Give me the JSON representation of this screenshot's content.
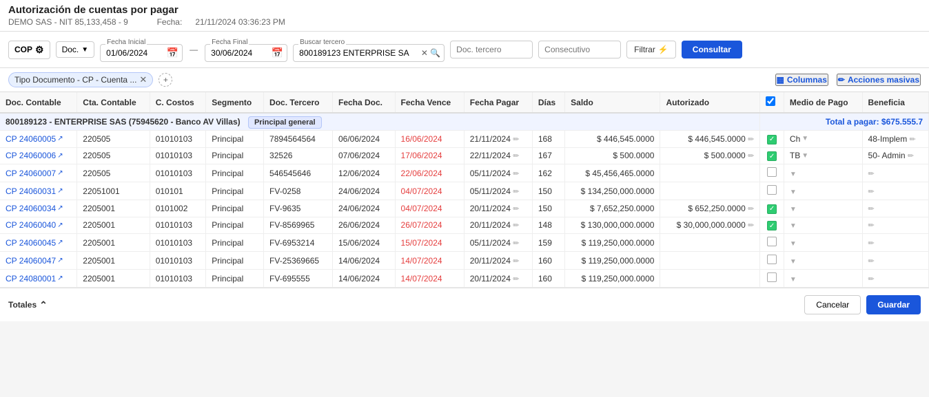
{
  "header": {
    "title": "Autorización de cuentas por pagar",
    "company": "DEMO SAS - NIT 85,133,458 - 9",
    "fecha_label": "Fecha:",
    "fecha_value": "21/11/2024 03:36:23 PM"
  },
  "toolbar": {
    "currency": "COP",
    "doc_label": "Doc.",
    "fecha_inicial_label": "Fecha Inicial",
    "fecha_inicial_value": "01/06/2024",
    "fecha_final_label": "Fecha Final",
    "fecha_final_value": "30/06/2024",
    "buscar_tercero_label": "Buscar tercero",
    "buscar_tercero_value": "800189123 ENTERPRISE SAS",
    "doc_tercero_placeholder": "Doc. tercero",
    "consecutivo_placeholder": "Consecutivo",
    "filtrar_label": "Filtrar",
    "consultar_label": "Consultar"
  },
  "subbar": {
    "tag_label": "Tipo Documento - CP - Cuenta ...",
    "columnas_label": "Columnas",
    "acciones_masivas_label": "Acciones masivas"
  },
  "table": {
    "headers": [
      "Doc. Contable",
      "Cta. Contable",
      "C. Costos",
      "Segmento",
      "Doc. Tercero",
      "Fecha Doc.",
      "Fecha Vence",
      "Fecha Pagar",
      "Días",
      "Saldo",
      "Autorizado",
      "",
      "Medio de Pago",
      "Beneficia"
    ],
    "group": {
      "label": "800189123 - ENTERPRISE SAS (75945620 - Banco AV Villas)",
      "tag": "Principal general",
      "total": "Total a pagar: $675.555.7"
    },
    "rows": [
      {
        "doc": "CP 24060005",
        "cta": "220505",
        "costos": "01010103",
        "segmento": "Principal",
        "doc_tercero": "7894564564",
        "fecha_doc": "06/06/2024",
        "fecha_vence": "16/06/2024",
        "fecha_pagar": "21/11/2024",
        "dias": "168",
        "saldo": "$ 446,545.0000",
        "autorizado": "$ 446,545.0000",
        "checked": true,
        "medio_pago": "Ch",
        "beneficia": "48-Implem"
      },
      {
        "doc": "CP 24060006",
        "cta": "220505",
        "costos": "01010103",
        "segmento": "Principal",
        "doc_tercero": "32526",
        "fecha_doc": "07/06/2024",
        "fecha_vence": "17/06/2024",
        "fecha_pagar": "22/11/2024",
        "dias": "167",
        "saldo": "$ 500.0000",
        "autorizado": "$ 500.0000",
        "checked": true,
        "medio_pago": "TB",
        "beneficia": "50- Admin"
      },
      {
        "doc": "CP 24060007",
        "cta": "220505",
        "costos": "01010103",
        "segmento": "Principal",
        "doc_tercero": "546545646",
        "fecha_doc": "12/06/2024",
        "fecha_vence": "22/06/2024",
        "fecha_pagar": "05/11/2024",
        "dias": "162",
        "saldo": "$ 45,456,465.0000",
        "autorizado": "",
        "checked": false,
        "medio_pago": "",
        "beneficia": ""
      },
      {
        "doc": "CP 24060031",
        "cta": "22051001",
        "costos": "010101",
        "segmento": "Principal",
        "doc_tercero": "FV-0258",
        "fecha_doc": "24/06/2024",
        "fecha_vence": "04/07/2024",
        "fecha_pagar": "05/11/2024",
        "dias": "150",
        "saldo": "$ 134,250,000.0000",
        "autorizado": "",
        "checked": false,
        "medio_pago": "",
        "beneficia": ""
      },
      {
        "doc": "CP 24060034",
        "cta": "2205001",
        "costos": "0101002",
        "segmento": "Principal",
        "doc_tercero": "FV-9635",
        "fecha_doc": "24/06/2024",
        "fecha_vence": "04/07/2024",
        "fecha_pagar": "20/11/2024",
        "dias": "150",
        "saldo": "$ 7,652,250.0000",
        "autorizado": "$ 652,250.0000",
        "checked": true,
        "medio_pago": "",
        "beneficia": ""
      },
      {
        "doc": "CP 24060040",
        "cta": "2205001",
        "costos": "01010103",
        "segmento": "Principal",
        "doc_tercero": "FV-8569965",
        "fecha_doc": "26/06/2024",
        "fecha_vence": "26/07/2024",
        "fecha_pagar": "20/11/2024",
        "dias": "148",
        "saldo": "$ 130,000,000.0000",
        "autorizado": "$ 30,000,000.0000",
        "checked": true,
        "medio_pago": "",
        "beneficia": ""
      },
      {
        "doc": "CP 24060045",
        "cta": "2205001",
        "costos": "01010103",
        "segmento": "Principal",
        "doc_tercero": "FV-6953214",
        "fecha_doc": "15/06/2024",
        "fecha_vence": "15/07/2024",
        "fecha_pagar": "05/11/2024",
        "dias": "159",
        "saldo": "$ 119,250,000.0000",
        "autorizado": "",
        "checked": false,
        "medio_pago": "",
        "beneficia": ""
      },
      {
        "doc": "CP 24060047",
        "cta": "2205001",
        "costos": "01010103",
        "segmento": "Principal",
        "doc_tercero": "FV-25369665",
        "fecha_doc": "14/06/2024",
        "fecha_vence": "14/07/2024",
        "fecha_pagar": "20/11/2024",
        "dias": "160",
        "saldo": "$ 119,250,000.0000",
        "autorizado": "",
        "checked": false,
        "medio_pago": "",
        "beneficia": ""
      },
      {
        "doc": "CP 24080001",
        "cta": "2205001",
        "costos": "01010103",
        "segmento": "Principal",
        "doc_tercero": "FV-695555",
        "fecha_doc": "14/06/2024",
        "fecha_vence": "14/07/2024",
        "fecha_pagar": "20/11/2024",
        "dias": "160",
        "saldo": "$ 119,250,000.0000",
        "autorizado": "",
        "checked": false,
        "medio_pago": "",
        "beneficia": ""
      }
    ]
  },
  "footer": {
    "totales_label": "Totales",
    "cancel_label": "Cancelar",
    "guardar_label": "Guardar"
  }
}
